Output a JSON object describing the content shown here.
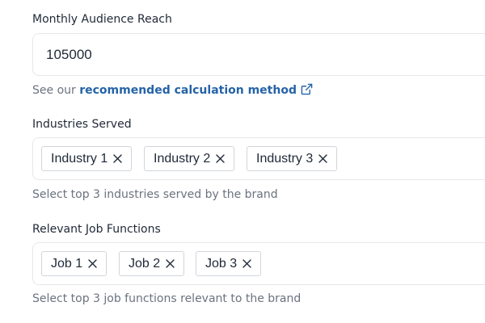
{
  "audience": {
    "label": "Monthly Audience Reach",
    "value": "105000",
    "helper_prefix": "See our ",
    "helper_link": "recommended calculation method"
  },
  "industries": {
    "label": "Industries Served",
    "chips": [
      "Industry 1",
      "Industry 2",
      "Industry 3"
    ],
    "helper": "Select top 3 industries served by the brand"
  },
  "jobs": {
    "label": "Relevant Job Functions",
    "chips": [
      "Job 1",
      "Job 2",
      "Job 3"
    ],
    "helper": "Select top 3 job functions relevant to the brand"
  },
  "icons": {
    "external_link": "external-link-icon",
    "remove": "close-icon"
  },
  "colors": {
    "link": "#2563a8",
    "label": "#1f2937",
    "helper": "#6b7280",
    "border": "#e5e7eb",
    "chip_border": "#d1d5db"
  }
}
